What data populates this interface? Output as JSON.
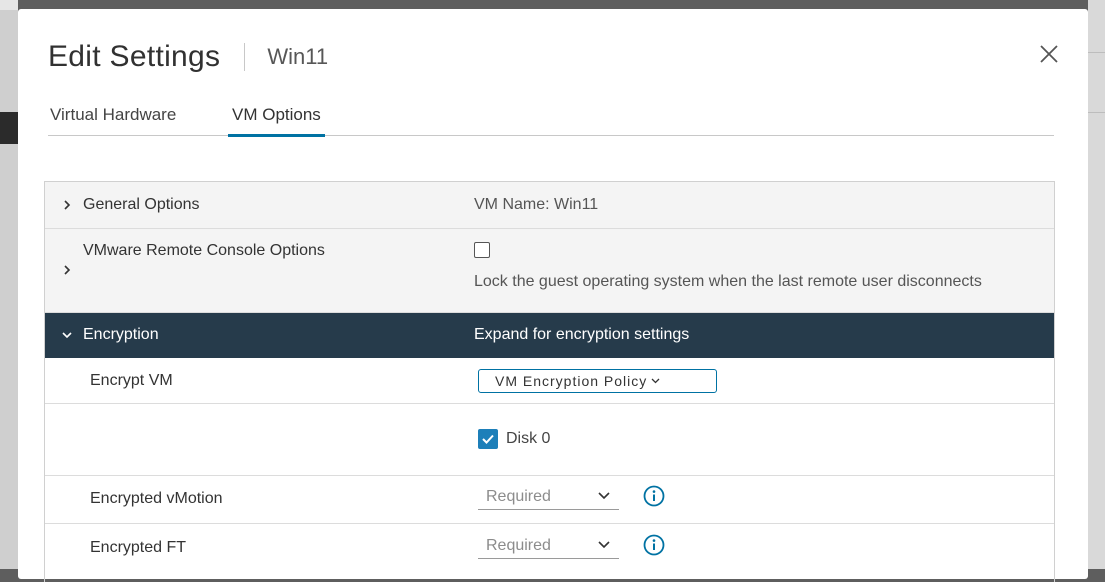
{
  "dialog": {
    "title": "Edit Settings",
    "subtitle": "Win11"
  },
  "tabs": [
    {
      "label": "Virtual Hardware",
      "active": false
    },
    {
      "label": "VM Options",
      "active": true
    }
  ],
  "rows": {
    "general": {
      "label": "General Options",
      "value": "VM Name: Win11"
    },
    "remote_console": {
      "label": "VMware Remote Console Options",
      "checkbox_checked": false,
      "description": "Lock the guest operating system when the last remote user disconnects"
    },
    "encryption": {
      "label": "Encryption",
      "value": "Expand for encryption settings",
      "expanded": true
    },
    "encrypt_vm": {
      "label": "Encrypt VM",
      "button_label": "VM Encryption Policy"
    },
    "disk": {
      "label": "Disk 0",
      "checked": true
    },
    "vmotion": {
      "label": "Encrypted vMotion",
      "select_value": "Required"
    },
    "ft": {
      "label": "Encrypted FT",
      "select_value": "Required"
    }
  },
  "colors": {
    "accent": "#0072a3",
    "header_dark": "#263b4b",
    "checkbox_blue": "#1d7fb9"
  }
}
